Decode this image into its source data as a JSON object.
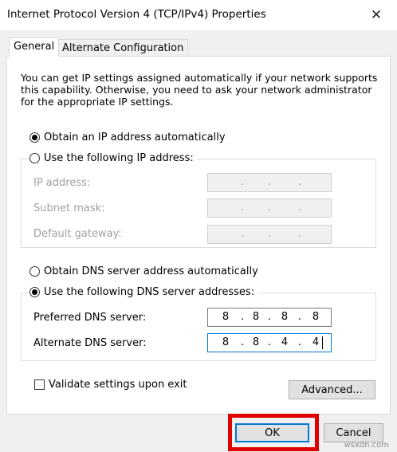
{
  "window": {
    "title": "Internet Protocol Version 4 (TCP/IPv4) Properties",
    "close_glyph": "✕"
  },
  "tabs": [
    {
      "label": "General",
      "active": true
    },
    {
      "label": "Alternate Configuration",
      "active": false
    }
  ],
  "description": "You can get IP settings assigned automatically if your network supports this capability. Otherwise, you need to ask your network administrator for the appropriate IP settings.",
  "ip_section": {
    "auto_label": "Obtain an IP address automatically",
    "manual_label": "Use the following IP address:",
    "auto_selected": true,
    "fields": [
      {
        "label": "IP address:",
        "octets": [
          "",
          "",
          "",
          ""
        ],
        "enabled": false
      },
      {
        "label": "Subnet mask:",
        "octets": [
          "",
          "",
          "",
          ""
        ],
        "enabled": false
      },
      {
        "label": "Default gateway:",
        "octets": [
          "",
          "",
          "",
          ""
        ],
        "enabled": false
      }
    ]
  },
  "dns_section": {
    "auto_label": "Obtain DNS server address automatically",
    "manual_label": "Use the following DNS server addresses:",
    "manual_selected": true,
    "fields": [
      {
        "label": "Preferred DNS server:",
        "octets": [
          "8",
          "8",
          "8",
          "8"
        ],
        "enabled": true
      },
      {
        "label": "Alternate DNS server:",
        "octets": [
          "8",
          "8",
          "4",
          "4"
        ],
        "enabled": true
      }
    ]
  },
  "validate": {
    "label": "Validate settings upon exit",
    "checked": false
  },
  "buttons": {
    "advanced": "Advanced...",
    "ok": "OK",
    "cancel": "Cancel"
  },
  "watermark": "wsxdn.com",
  "colors": {
    "highlight": "#e00000",
    "focus": "#0078d7",
    "dialog_bg": "#f0f0f0"
  }
}
